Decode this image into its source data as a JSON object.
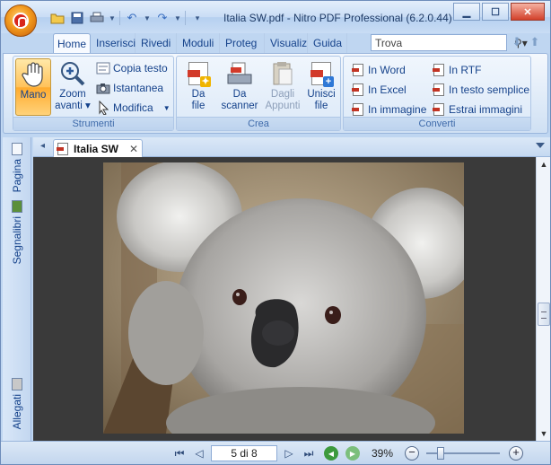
{
  "window": {
    "title": "Italia SW.pdf - Nitro PDF Professional (6.2.0.44)"
  },
  "ribbon_tabs": [
    "Home",
    "Inserisci",
    "Rivedi",
    "Moduli",
    "Proteg",
    "Visualiz",
    "Guida"
  ],
  "search": {
    "placeholder": "Trova",
    "value": "Trova"
  },
  "groups": {
    "strumenti": {
      "label": "Strumenti",
      "mano": "Mano",
      "zoom_line1": "Zoom",
      "zoom_line2": "avanti",
      "copia_testo": "Copia testo",
      "istantanea": "Istantanea",
      "modifica": "Modifica"
    },
    "crea": {
      "label": "Crea",
      "da_file_1": "Da",
      "da_file_2": "file",
      "da_scanner_1": "Da",
      "da_scanner_2": "scanner",
      "dagli_appunti_1": "Dagli",
      "dagli_appunti_2": "Appunti",
      "unisci_file_1": "Unisci",
      "unisci_file_2": "file"
    },
    "converti": {
      "label": "Converti",
      "in_word": "In Word",
      "in_excel": "In Excel",
      "in_immagine": "In immagine",
      "in_rtf": "In RTF",
      "in_testo_semplice": "In testo semplice",
      "estrai_immagini": "Estrai immagini"
    }
  },
  "document_tab": {
    "label": "Italia SW"
  },
  "sidebar": {
    "pagina": "Pagina",
    "segnalibri": "Segnalibri",
    "allegati": "Allegati"
  },
  "statusbar": {
    "page_indicator": "5 di 8",
    "zoom": "39%"
  },
  "icons": {
    "orb": "nitro-logo-icon",
    "open": "folder-open-icon",
    "save": "save-icon",
    "print": "print-icon",
    "undo": "undo-icon",
    "redo": "redo-icon"
  },
  "colors": {
    "accent": "#15428b",
    "active_button": "#ffc25a",
    "ribbon_bg": "#dbe8f7",
    "viewer_bg": "#3a3a3a"
  }
}
